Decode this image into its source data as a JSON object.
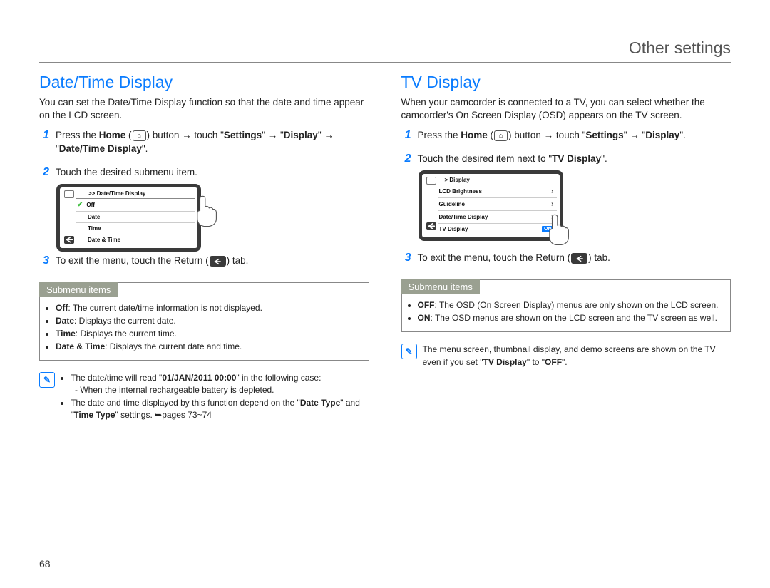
{
  "header": {
    "title": "Other settings"
  },
  "page_number": "68",
  "left": {
    "section_title": "Date/Time Display",
    "intro": "You can set the Date/Time Display function so that the date and time appear on the LCD screen.",
    "steps": {
      "s1": {
        "a": "Press the ",
        "b1": "Home",
        "c": " button ",
        "arr": "→",
        "d": " touch \"",
        "b2": "Settings",
        "e": "\" ",
        "f": " \"",
        "b3": "Display",
        "g": "\" ",
        "h": " \"",
        "b4": "Date/Time Display",
        "i": "\"."
      },
      "s2": "Touch the desired submenu item.",
      "s3": {
        "a": "To exit the menu, touch the Return (",
        "b": ") tab."
      }
    },
    "lcd": {
      "crumb": ">> Date/Time Display",
      "items": [
        "Off",
        "Date",
        "Time",
        "Date & Time"
      ]
    },
    "submenu": {
      "title": "Submenu items",
      "items": [
        {
          "b": "Off",
          "t": ": The current date/time information is not displayed."
        },
        {
          "b": "Date",
          "t": ": Displays the current date."
        },
        {
          "b": "Time",
          "t": ": Displays the current time."
        },
        {
          "b": "Date & Time",
          "t": ": Displays the current date and time."
        }
      ]
    },
    "note": {
      "line1a": "The date/time will read \"",
      "line1b": "01/JAN/2011 00:00",
      "line1c": "\" in the following case:",
      "sub1": "- When the internal rechargeable battery is depleted.",
      "line2a": "The date and time displayed by this function depend on the \"",
      "line2b": "Date Type",
      "line2c": "\" and \"",
      "line2d": "Time Type",
      "line2e": "\" settings. ",
      "line2f": "pages 73~74"
    }
  },
  "right": {
    "section_title": "TV Display",
    "intro": "When your camcorder is connected to a TV, you can select whether the camcorder's On Screen Display (OSD) appears on the TV screen.",
    "steps": {
      "s1": {
        "a": "Press the ",
        "b1": "Home",
        "c": " button ",
        "arr": "→",
        "d": " touch \"",
        "b2": "Settings",
        "e": "\" ",
        "f": " \"",
        "b3": "Display",
        "g": "\"."
      },
      "s2": {
        "a": "Touch the desired item next to \"",
        "b": "TV Display",
        "c": "\"."
      },
      "s3": {
        "a": "To exit the menu, touch the Return (",
        "b": ") tab."
      }
    },
    "lcd": {
      "crumb": "> Display",
      "items": [
        "LCD Brightness",
        "Guideline",
        "Date/Time Display",
        "TV Display"
      ],
      "on": "ON"
    },
    "submenu": {
      "title": "Submenu items",
      "items": [
        {
          "b": "OFF",
          "t": ": The OSD (On Screen Display) menus are only shown on the LCD screen."
        },
        {
          "b": "ON",
          "t": ": The OSD menus are shown on the LCD screen and the TV screen as well."
        }
      ]
    },
    "note": {
      "a": "The menu screen, thumbnail display, and demo screens are shown on the TV even if you set \"",
      "b": "TV Display",
      "c": "\" to \"",
      "d": "OFF",
      "e": "\"."
    }
  }
}
